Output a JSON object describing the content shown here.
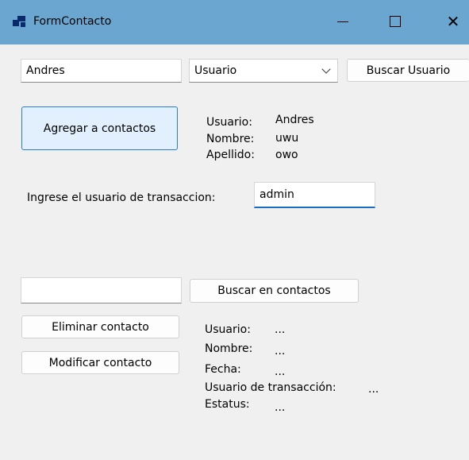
{
  "window": {
    "title": "FormContacto",
    "icon": "app-window-icon",
    "controls": {
      "minimize": "minimize-icon",
      "maximize": "maximize-icon",
      "close": "close-icon"
    }
  },
  "search_user": {
    "input_value": "Andres",
    "type_selected": "Usuario",
    "button_label": "Buscar Usuario"
  },
  "add_contact": {
    "button_label": "Agregar a contactos",
    "details": {
      "usuario_label": "Usuario:",
      "usuario_value": "Andres",
      "nombre_label": "Nombre:",
      "nombre_value": "uwu",
      "apellido_label": "Apellido:",
      "apellido_value": "owo"
    }
  },
  "transaction": {
    "label": "Ingrese el usuario de transaccion:",
    "value": "admin"
  },
  "contacts": {
    "search_value": "",
    "search_button_label": "Buscar en contactos",
    "delete_button_label": "Eliminar contacto",
    "modify_button_label": "Modificar contacto",
    "details": {
      "usuario_label": "Usuario:",
      "usuario_value": "...",
      "nombre_label": "Nombre:",
      "nombre_value": "...",
      "fecha_label": "Fecha:",
      "fecha_value": "...",
      "usuario_transaccion_label": "Usuario de transacción:",
      "usuario_transaccion_value": "...",
      "estatus_label": "Estatus:",
      "estatus_value": "..."
    }
  }
}
